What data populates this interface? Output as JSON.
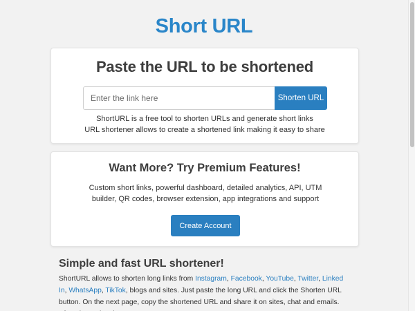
{
  "header": {
    "title": "Short URL"
  },
  "shorten": {
    "heading": "Paste the URL to be shortened",
    "placeholder": "Enter the link here",
    "button_label": "Shorten URL",
    "desc_line1": "ShortURL is a free tool to shorten URLs and generate short links",
    "desc_line2": "URL shortener allows to create a shortened link making it easy to share"
  },
  "premium": {
    "heading": "Want More? Try Premium Features!",
    "features_text": "Custom short links, powerful dashboard, detailed analytics, API, UTM builder, QR codes, browser extension, app integrations and support",
    "button_label": "Create Account"
  },
  "info": {
    "title": "Simple and fast URL shortener!",
    "intro": "ShortURL allows to shorten long links from",
    "links": [
      "Instagram",
      "Facebook",
      "YouTube",
      "Twitter",
      "Linked In",
      "WhatsApp",
      "TikTok"
    ],
    "after_links": ", blogs and sites. Just paste the long URL and click the Shorten URL button. On the next page, copy the shortened URL and share it on sites, chat and emails. After shortening the"
  },
  "colors": {
    "brand": "#2a86c9",
    "button": "#2a7fc0"
  }
}
